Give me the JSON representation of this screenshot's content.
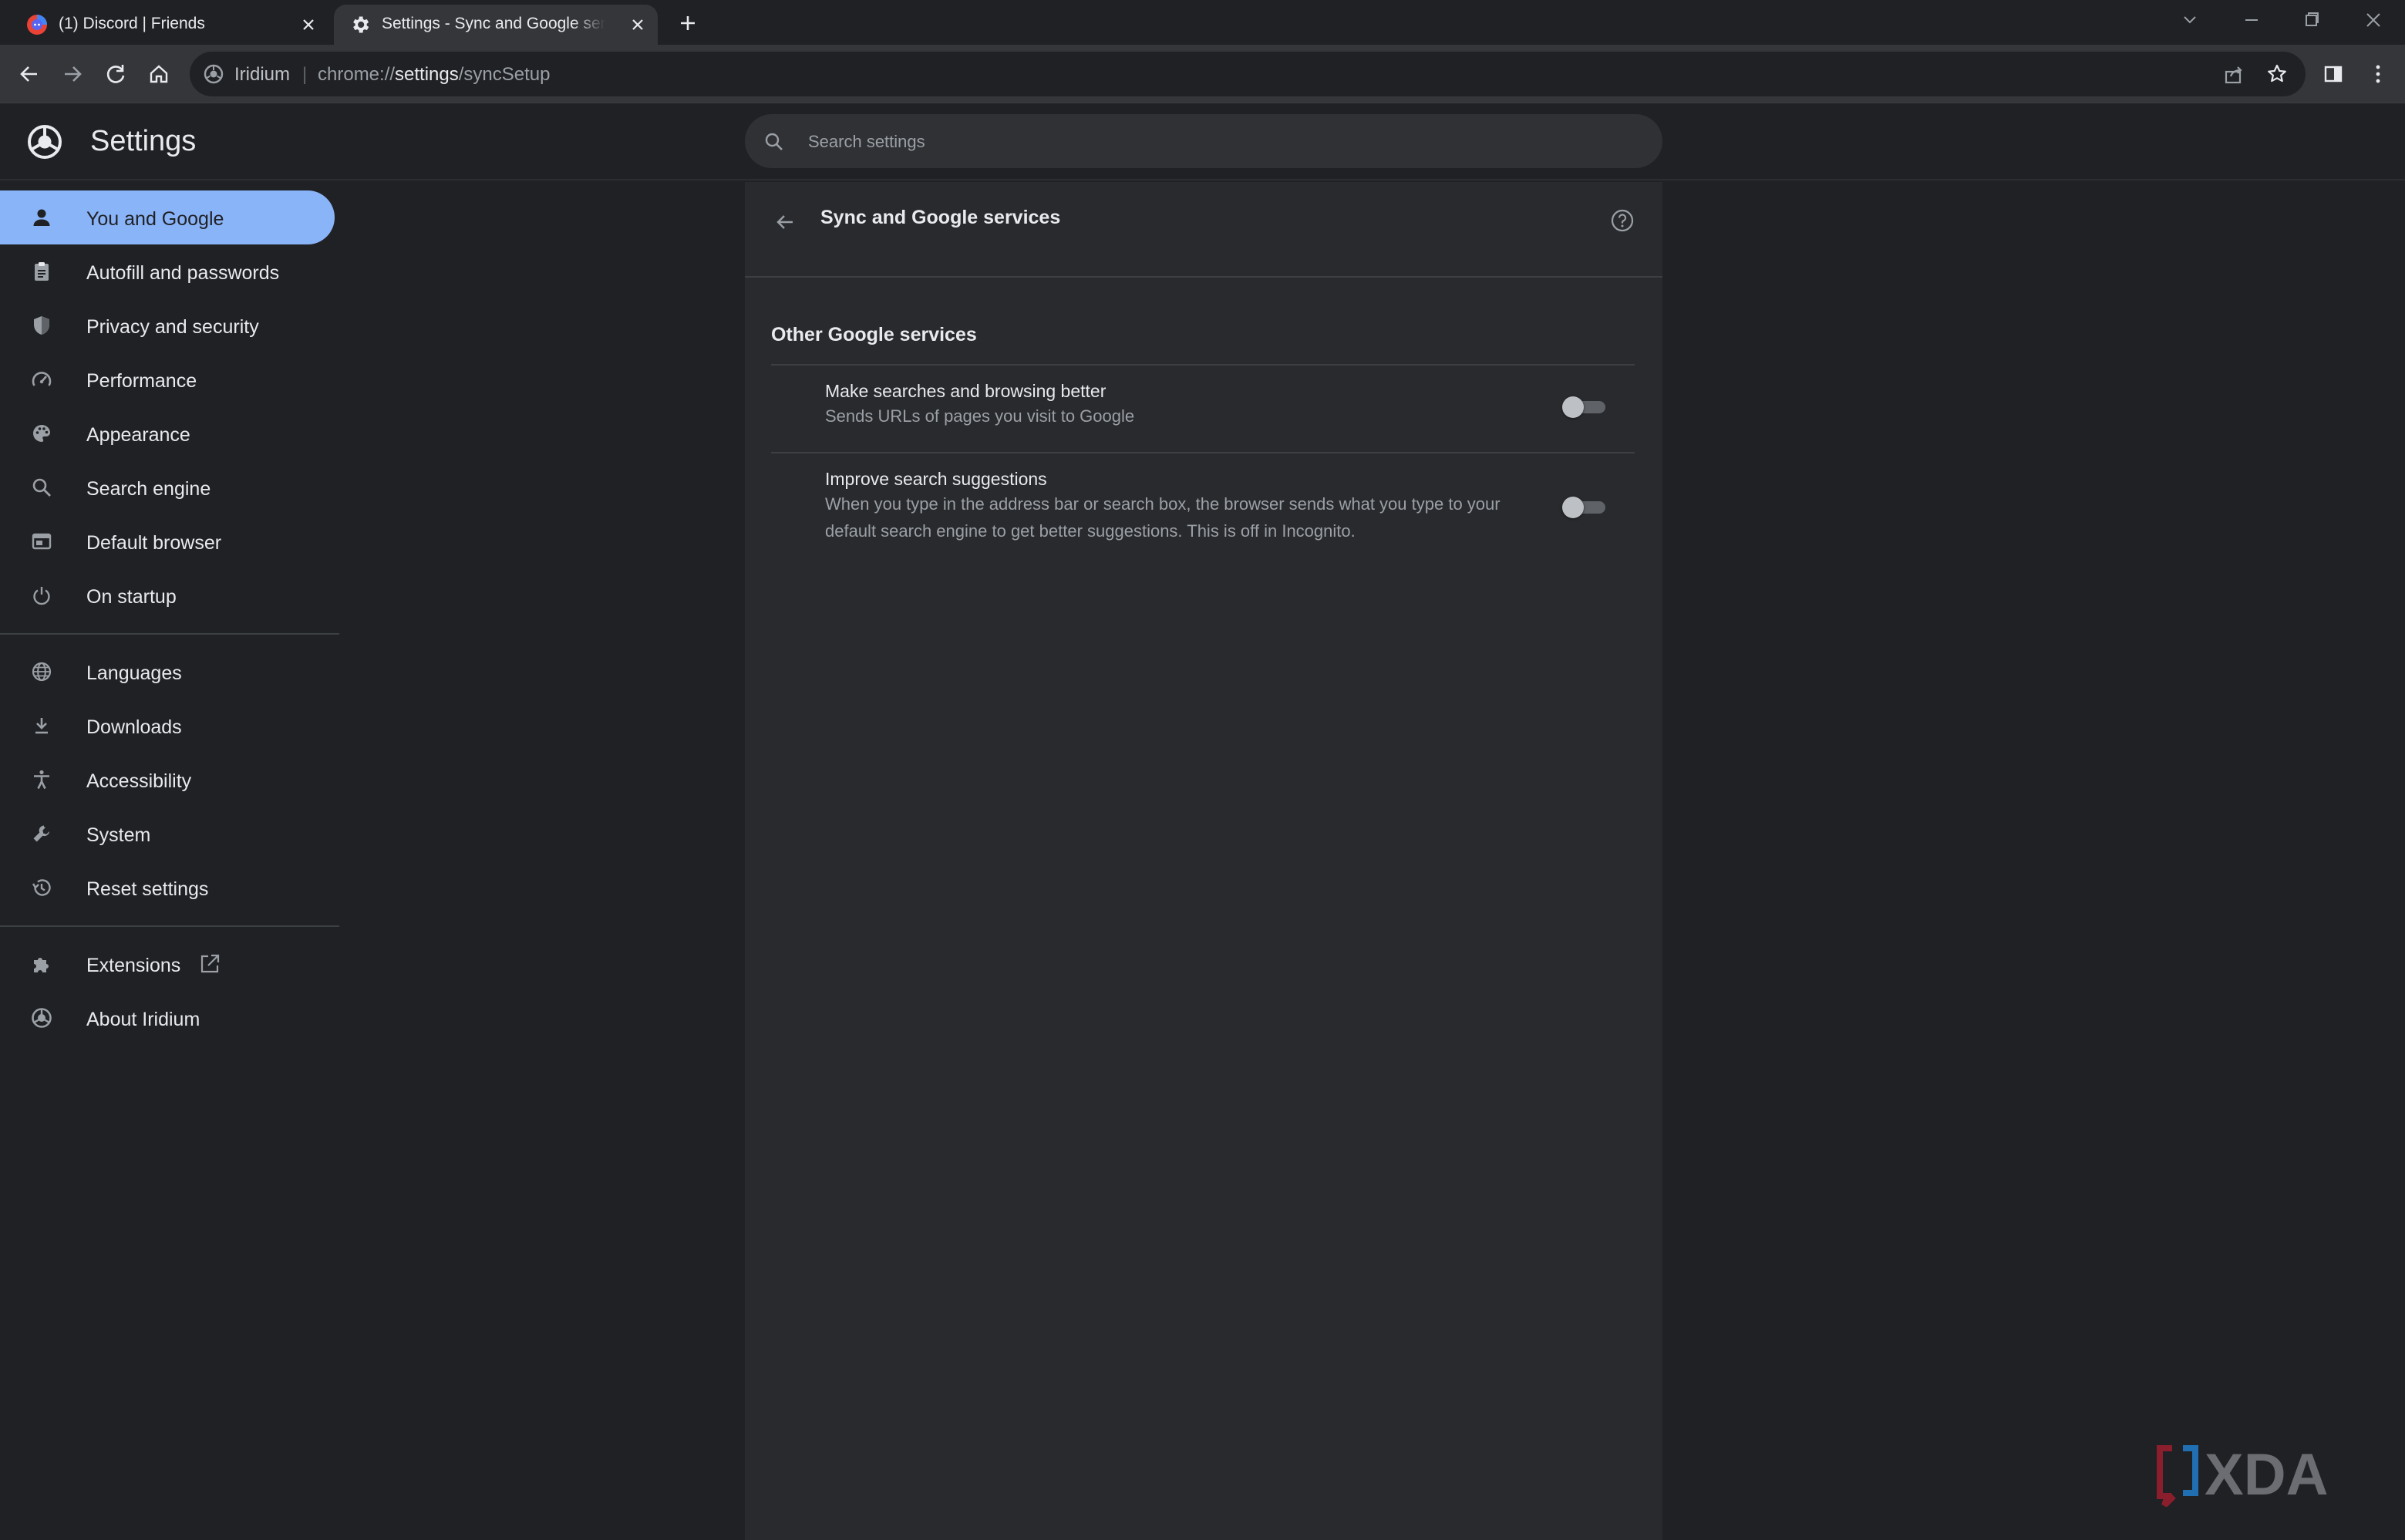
{
  "browser": {
    "tabs": [
      {
        "title": "(1) Discord | Friends",
        "icon": "discord-icon",
        "active": false
      },
      {
        "title": "Settings - Sync and Google services",
        "icon": "gear-icon",
        "active": true
      }
    ],
    "omnibox": {
      "site_name": "Iridium",
      "separator": "|",
      "url_prefix": "chrome://",
      "url_host": "settings",
      "url_path": "/syncSetup"
    }
  },
  "settings": {
    "title": "Settings",
    "search_placeholder": "Search settings",
    "sidebar": {
      "items": [
        {
          "label": "You and Google",
          "icon": "person-icon",
          "active": true
        },
        {
          "label": "Autofill and passwords",
          "icon": "clipboard-icon"
        },
        {
          "label": "Privacy and security",
          "icon": "shield-icon"
        },
        {
          "label": "Performance",
          "icon": "speedometer-icon"
        },
        {
          "label": "Appearance",
          "icon": "palette-icon"
        },
        {
          "label": "Search engine",
          "icon": "search-icon"
        },
        {
          "label": "Default browser",
          "icon": "browser-window-icon"
        },
        {
          "label": "On startup",
          "icon": "power-icon"
        },
        {
          "label": "Languages",
          "icon": "globe-icon"
        },
        {
          "label": "Downloads",
          "icon": "download-icon"
        },
        {
          "label": "Accessibility",
          "icon": "accessibility-icon"
        },
        {
          "label": "System",
          "icon": "wrench-icon"
        },
        {
          "label": "Reset settings",
          "icon": "history-icon"
        },
        {
          "label": "Extensions",
          "icon": "puzzle-icon"
        },
        {
          "label": "About Iridium",
          "icon": "iridium-logo-icon"
        }
      ]
    },
    "page": {
      "title": "Sync and Google services",
      "section_heading": "Other Google services",
      "rows": [
        {
          "title": "Make searches and browsing better",
          "description": "Sends URLs of pages you visit to Google",
          "enabled": false
        },
        {
          "title": "Improve search suggestions",
          "description": "When you type in the address bar or search box, the browser sends what you type to your default search engine to get better suggestions. This is off in Incognito.",
          "enabled": false
        }
      ]
    }
  },
  "watermark": "XDA",
  "colors": {
    "accent": "#8ab4f8",
    "background": "#202124",
    "card": "#292a2d",
    "toolbar": "#35363a"
  }
}
